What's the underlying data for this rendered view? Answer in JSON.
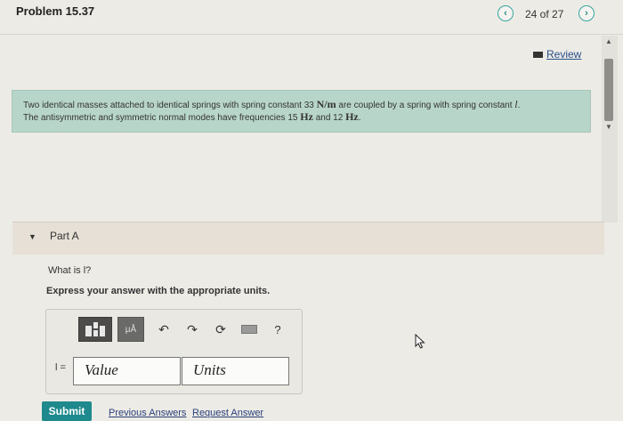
{
  "header": {
    "title": "Problem 15.37",
    "pager": "24 of 27",
    "prev_icon": "‹",
    "next_icon": "›"
  },
  "review": {
    "label": "Review"
  },
  "problem": {
    "line1_a": "Two identical masses attached to identical springs with spring constant 33 ",
    "line1_unit": "N/m",
    "line1_b": " are coupled by a spring with spring constant ",
    "line1_var": "l",
    "line1_end": ".",
    "line2_a": "The antisymmetric and symmetric normal modes have frequencies 15 ",
    "line2_u1": "Hz",
    "line2_b": " and 12 ",
    "line2_u2": "Hz",
    "line2_end": "."
  },
  "part": {
    "label": "Part A",
    "question": "What is l?",
    "instruction": "Express your answer with the appropriate units."
  },
  "answer": {
    "var_label": "l =",
    "value_placeholder": "Value",
    "units_placeholder": "Units",
    "mu_label": "μÅ",
    "help_label": "?"
  },
  "actions": {
    "submit": "Submit",
    "previous_answers": "Previous Answers",
    "request_answer": "Request Answer"
  },
  "colors": {
    "accent": "#1f8a8e",
    "problem_bg": "#b8d5c9",
    "part_bg": "#e6e0d7"
  }
}
